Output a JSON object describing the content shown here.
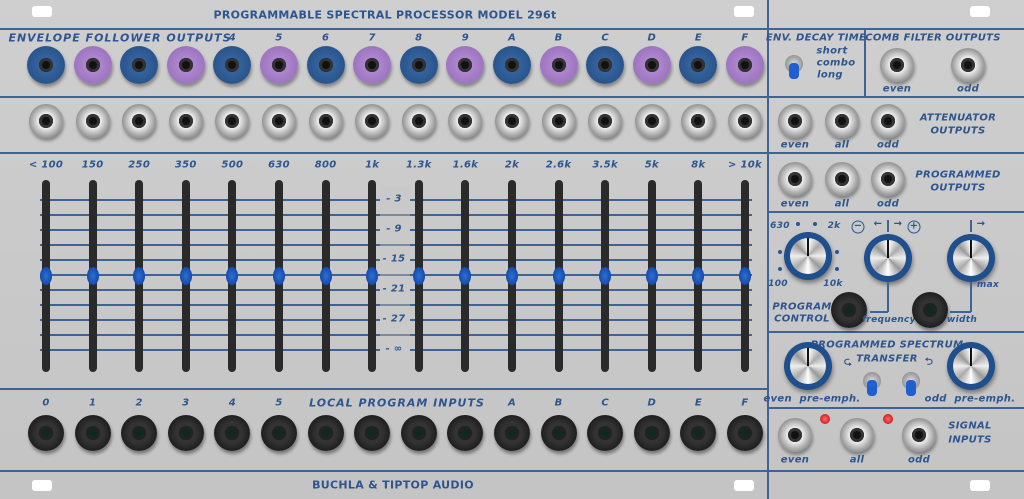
{
  "title": "PROGRAMMABLE SPECTRAL PROCESSOR MODEL 296t",
  "footer": "BUCHLA & TIPTOP AUDIO",
  "colors": {
    "panel": "#c8c8c8",
    "text": "#2d5590",
    "blue_jack": "#2f5e94",
    "purple_jack": "#a87fc9",
    "slider_knob": "#1f5fd0",
    "led": "#e00000"
  },
  "envelope_outputs": {
    "label": "ENVELOPE FOLLOWER OUTPUTS",
    "channel_labels": [
      "4",
      "5",
      "6",
      "7",
      "8",
      "9",
      "A",
      "B",
      "C",
      "D",
      "E",
      "F"
    ],
    "jack_colors": [
      "blue",
      "purple",
      "blue",
      "purple",
      "blue",
      "purple",
      "blue",
      "purple",
      "blue",
      "purple",
      "blue",
      "purple",
      "blue",
      "purple",
      "blue",
      "purple"
    ]
  },
  "sliders": {
    "band_labels": [
      "< 100",
      "150",
      "250",
      "350",
      "500",
      "630",
      "800",
      "1k",
      "1.3k",
      "1.6k",
      "2k",
      "2.6k",
      "3.5k",
      "5k",
      "8k",
      "> 10k"
    ],
    "scale_labels": [
      "- 3",
      "- 9",
      "- 15",
      "- 21",
      "- 27",
      "- ∞"
    ],
    "positions": [
      0.5,
      0.5,
      0.5,
      0.5,
      0.5,
      0.5,
      0.5,
      0.5,
      0.5,
      0.5,
      0.5,
      0.5,
      0.5,
      0.5,
      0.5,
      0.5
    ]
  },
  "program_inputs": {
    "label": "LOCAL PROGRAM INPUTS",
    "left_labels": [
      "0",
      "1",
      "2",
      "3",
      "4",
      "5"
    ],
    "right_labels": [
      "A",
      "B",
      "C",
      "D",
      "E",
      "F"
    ]
  },
  "right": {
    "env_decay": {
      "title": "ENV. DECAY TIME",
      "options": [
        "short",
        "combo",
        "long"
      ],
      "selected": "long"
    },
    "comb": {
      "title": "COMB FILTER OUTPUTS",
      "even": "even",
      "odd": "odd"
    },
    "attenuator": {
      "title1": "ATTENUATOR",
      "title2": "OUTPUTS",
      "even": "even",
      "all": "all",
      "odd": "odd"
    },
    "programmed": {
      "title1": "PROGRAMMED",
      "title2": "OUTPUTS",
      "even": "even",
      "all": "all",
      "odd": "odd"
    },
    "program_control": {
      "title1": "PROGRAM",
      "title2": "CONTROL",
      "freq_scale": [
        "630",
        "2k",
        "100",
        "10k"
      ],
      "frequency": "frequency",
      "width": "width",
      "max": "max",
      "minus": "−",
      "plus": "+"
    },
    "spectrum": {
      "title1": "PROGRAMMED SPECTRUM",
      "title2": "TRANSFER",
      "even_label": "even  pre-emph.",
      "odd_label": "odd  pre-emph."
    },
    "signal": {
      "title1": "SIGNAL",
      "title2": "INPUTS",
      "even": "even",
      "all": "all",
      "odd": "odd"
    }
  }
}
